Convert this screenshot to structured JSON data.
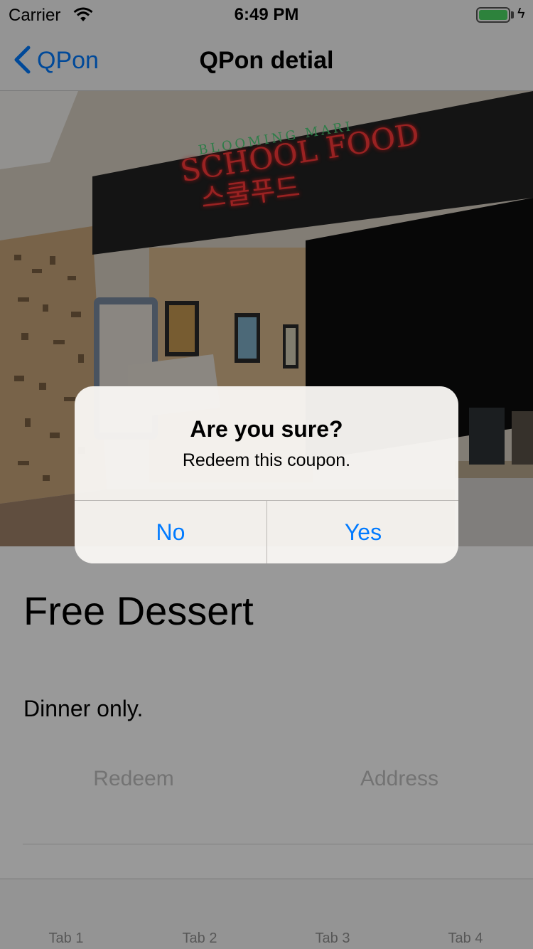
{
  "status_bar": {
    "carrier": "Carrier",
    "time": "6:49 PM",
    "battery_level": 1.0,
    "battery_color": "#4cd964"
  },
  "nav": {
    "back_label": "QPon",
    "title": "QPon detial"
  },
  "hero": {
    "sign_small": "BLOOMING MARI",
    "sign_main": "SCHOOL FOOD",
    "sign_korean": "스쿨푸드"
  },
  "deal": {
    "title": "Free Dessert",
    "description": "Dinner only.",
    "redeem_label": "Redeem",
    "address_label": "Address"
  },
  "tabs": [
    {
      "label": "Tab 1"
    },
    {
      "label": "Tab 2"
    },
    {
      "label": "Tab 3"
    },
    {
      "label": "Tab 4"
    }
  ],
  "alert": {
    "title": "Are you sure?",
    "message": "Redeem this coupon.",
    "no_label": "No",
    "yes_label": "Yes"
  },
  "colors": {
    "accent": "#007aff",
    "disabled_text": "#c0c0c0",
    "tab_inactive": "#929292"
  }
}
